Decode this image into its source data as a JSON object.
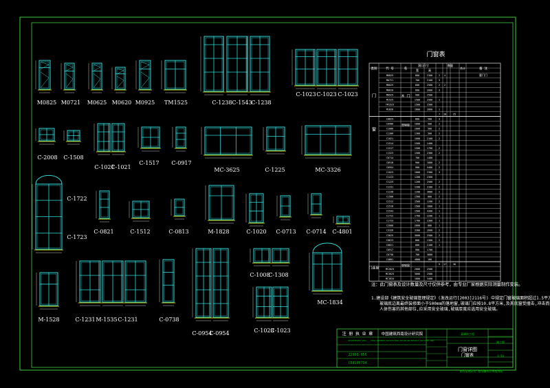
{
  "colors": {
    "background": "#000000",
    "frame": "#3ad03a",
    "window": "#2fd9d9",
    "table": "#e8e8e8",
    "text": "#ffffff",
    "accent": "#00c000",
    "sill": "#c8c000"
  },
  "table": {
    "title": "门窗表",
    "header": [
      "类别",
      "代 号",
      "名",
      "洞 口 尺 寸",
      "宽",
      "高",
      "数 量",
      "备 注",
      "数量",
      "合计"
    ],
    "header_short": {
      "cat": "类别",
      "code": "代 号",
      "name": "名",
      "size": "洞口尺寸",
      "w": "宽",
      "h": "高",
      "qty": "数量",
      "total": "合计",
      "remark": "备 注"
    },
    "door_group": "门",
    "door_name": "木 门",
    "window_group": "窗",
    "window_name": "塑钢窗",
    "door_window_group": "门连窗",
    "door_window_name": "塑钢窗",
    "remark_first": "夏门门",
    "rows": [
      [
        "M0825",
        "800",
        "2300",
        "2",
        "4",
        ""
      ],
      [
        "M0721",
        "700",
        "2100",
        "3",
        "",
        ""
      ],
      [
        "M0625",
        "600",
        "2500",
        "2",
        "2",
        ""
      ],
      [
        "M0620",
        "600",
        "2000",
        "3",
        "",
        ""
      ],
      [
        "M0925",
        "900",
        "2500",
        "",
        "",
        ""
      ],
      [
        "M1525",
        "1500",
        "2500",
        "1",
        "",
        ""
      ],
      [
        "TM1525",
        "1500",
        "2500",
        "",
        "",
        ""
      ],
      [
        "M1828",
        "1800",
        "2800",
        "1",
        "",
        ""
      ],
      [
        "",
        "",
        "",
        "7",
        "16",
        "25"
      ],
      [
        "C0825",
        "800",
        "500",
        "3",
        "",
        ""
      ],
      [
        "C0906",
        "1000",
        "500",
        "2",
        "",
        ""
      ],
      [
        "C1006",
        "1000",
        "500",
        "2",
        "",
        ""
      ],
      [
        "C1306",
        "1300",
        "500",
        "2",
        "",
        ""
      ],
      [
        "C1021",
        "1000",
        "2100",
        "2",
        "",
        ""
      ],
      [
        "C1514",
        "1500",
        "1400",
        "",
        "",
        ""
      ],
      [
        "C1517",
        "1500",
        "1700",
        "2",
        "",
        ""
      ],
      [
        "C1523",
        "1500",
        "2300",
        "2",
        "",
        ""
      ],
      [
        "C0714",
        "700",
        "1400",
        "",
        "",
        ""
      ],
      [
        "C0918",
        "900",
        "1800",
        "2",
        "",
        ""
      ],
      [
        "C0954",
        "900",
        "5400",
        "2",
        "",
        ""
      ],
      [
        "C1023",
        "1000",
        "2300",
        "3",
        "",
        ""
      ],
      [
        "C1223",
        "1200",
        "2300",
        "",
        "",
        ""
      ],
      [
        "C1225",
        "1200",
        "2500",
        "2",
        "",
        ""
      ],
      [
        "C1231",
        "1200",
        "3100",
        "2",
        "",
        ""
      ],
      [
        "C1238",
        "1200",
        "3800",
        "2",
        "",
        ""
      ],
      [
        "C1508",
        "1500",
        "800",
        "2",
        "",
        ""
      ],
      [
        "C1512",
        "1500",
        "1200",
        "2",
        "",
        ""
      ],
      [
        "C1518",
        "1500",
        "1800",
        "1",
        "",
        ""
      ],
      [
        "C1543",
        "1500",
        "4300",
        "1",
        "",
        ""
      ],
      [
        "C1722",
        "1700",
        "2200",
        "1",
        "",
        ""
      ],
      [
        "C1723",
        "1700",
        "2300",
        "1",
        "",
        ""
      ],
      [
        "C2008",
        "2000",
        "800",
        "1",
        "",
        ""
      ],
      [
        "C3326",
        "3300",
        "2600",
        "2",
        "",
        ""
      ],
      [
        "C3625",
        "3600",
        "2500",
        "2",
        "",
        ""
      ],
      [
        "C0813",
        "800",
        "1300",
        "2",
        "",
        ""
      ],
      [
        "C0821",
        "800",
        "2100",
        "1",
        "",
        ""
      ],
      [
        "C0917",
        "900",
        "1700",
        "",
        "",
        ""
      ],
      [
        "C0738",
        "700",
        "3800",
        "",
        "",
        ""
      ],
      [
        "C4801",
        "4800",
        "100",
        "",
        "",
        ""
      ],
      [
        "",
        "",
        "",
        "9",
        "17",
        "36"
      ],
      [
        "MC2025",
        "2000",
        "2500",
        "",
        "",
        ""
      ],
      [
        "MC3625",
        "3600",
        "2500",
        "",
        "",
        ""
      ],
      [
        "MC1834",
        "1800",
        "3400",
        "",
        "",
        ""
      ]
    ],
    "note1": "注：此门窗表及设计数量及尺寸仅供参考，由专业厂家根据实际测量制作安装。",
    "note2_line1": "1.建设部《建筑安全玻璃管理规定》(发改运行[2003]2116号) 中规定门窗玻璃面积超过1.5平方米",
    "note2_line2": "玻璃底边离最终装修面小于500mm的落地窗,玻璃门应按10.8平方米,及其底窗受撞击,冲击而造成",
    "note2_line3": "人体伤害的其他部位,应采用安全玻璃,玻璃厚度应选用安全玻璃。"
  },
  "labels": {
    "M0825": "M0825",
    "M0721": "M0721",
    "M0625": "M0625",
    "M0620": "M0620",
    "M0925": "M0925",
    "TM1525": "TM1525",
    "C1238a": "C-1238",
    "C1543": "C-1543",
    "C1238b": "C-1238",
    "C1023a": "C-1023",
    "C1023b": "C-1023",
    "C1023c": "C-1023",
    "C2008": "C-2008",
    "C1508": "C-1508",
    "C1021a": "C-1021",
    "C1021b": "C-1021",
    "C1517": "C-1517",
    "C0917": "C-0917",
    "MC3625": "MC-3625",
    "C1225": "C-1225",
    "MC3326": "MC-3326",
    "C1722": "C-1722",
    "C1723": "C-1723",
    "C0821": "C-0821",
    "C1512": "C-1512",
    "C0813": "C-0813",
    "M1828": "M-1828",
    "C1020": "C-1020",
    "C0713": "C-0713",
    "C0714": "C-0714",
    "C4801": "C-4801",
    "M1528": "M-1528",
    "C1231a": "C-1231",
    "M1535": "M-1535",
    "C1231b": "C-1231",
    "C0738": "C-0738",
    "C0954a": "C-0954",
    "C0954b": "C-0954",
    "C1008": "C-1008",
    "C1308": "C-1308",
    "C1023d": "C-1023",
    "C1023e": "C-1023",
    "MC1834": "MC-1834"
  },
  "title_block": {
    "reg_title": "注 册 执 业 章",
    "reg_sub": "REGISTERED SEAL",
    "company": "中国建筑西南设计研究院",
    "company_en": "CHINA SOUTHWEST ARCHITECTURAL DESIGN AND RESEARCH INSTITUTE CORP",
    "code_a": "22008-056",
    "code_b": "C08100734",
    "drawing_title": "门窗详图",
    "drawing_sub": "门窗表",
    "project": "某建筑工程",
    "stage": "施工图",
    "scale": "1:50",
    "footer": "图号说明示范 图纸编号以本图为准"
  }
}
